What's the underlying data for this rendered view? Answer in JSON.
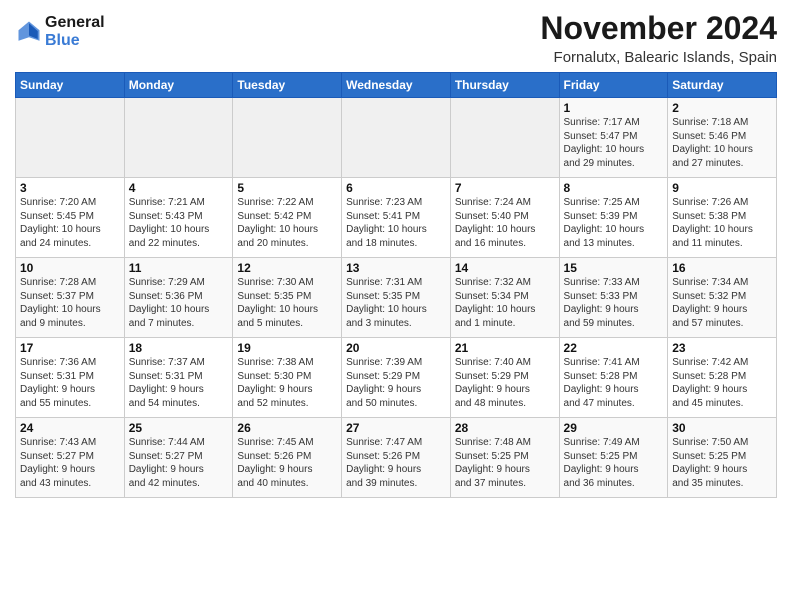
{
  "logo": {
    "line1": "General",
    "line2": "Blue"
  },
  "header": {
    "title": "November 2024",
    "subtitle": "Fornalutx, Balearic Islands, Spain"
  },
  "weekdays": [
    "Sunday",
    "Monday",
    "Tuesday",
    "Wednesday",
    "Thursday",
    "Friday",
    "Saturday"
  ],
  "weeks": [
    [
      {
        "day": "",
        "info": ""
      },
      {
        "day": "",
        "info": ""
      },
      {
        "day": "",
        "info": ""
      },
      {
        "day": "",
        "info": ""
      },
      {
        "day": "",
        "info": ""
      },
      {
        "day": "1",
        "info": "Sunrise: 7:17 AM\nSunset: 5:47 PM\nDaylight: 10 hours\nand 29 minutes."
      },
      {
        "day": "2",
        "info": "Sunrise: 7:18 AM\nSunset: 5:46 PM\nDaylight: 10 hours\nand 27 minutes."
      }
    ],
    [
      {
        "day": "3",
        "info": "Sunrise: 7:20 AM\nSunset: 5:45 PM\nDaylight: 10 hours\nand 24 minutes."
      },
      {
        "day": "4",
        "info": "Sunrise: 7:21 AM\nSunset: 5:43 PM\nDaylight: 10 hours\nand 22 minutes."
      },
      {
        "day": "5",
        "info": "Sunrise: 7:22 AM\nSunset: 5:42 PM\nDaylight: 10 hours\nand 20 minutes."
      },
      {
        "day": "6",
        "info": "Sunrise: 7:23 AM\nSunset: 5:41 PM\nDaylight: 10 hours\nand 18 minutes."
      },
      {
        "day": "7",
        "info": "Sunrise: 7:24 AM\nSunset: 5:40 PM\nDaylight: 10 hours\nand 16 minutes."
      },
      {
        "day": "8",
        "info": "Sunrise: 7:25 AM\nSunset: 5:39 PM\nDaylight: 10 hours\nand 13 minutes."
      },
      {
        "day": "9",
        "info": "Sunrise: 7:26 AM\nSunset: 5:38 PM\nDaylight: 10 hours\nand 11 minutes."
      }
    ],
    [
      {
        "day": "10",
        "info": "Sunrise: 7:28 AM\nSunset: 5:37 PM\nDaylight: 10 hours\nand 9 minutes."
      },
      {
        "day": "11",
        "info": "Sunrise: 7:29 AM\nSunset: 5:36 PM\nDaylight: 10 hours\nand 7 minutes."
      },
      {
        "day": "12",
        "info": "Sunrise: 7:30 AM\nSunset: 5:35 PM\nDaylight: 10 hours\nand 5 minutes."
      },
      {
        "day": "13",
        "info": "Sunrise: 7:31 AM\nSunset: 5:35 PM\nDaylight: 10 hours\nand 3 minutes."
      },
      {
        "day": "14",
        "info": "Sunrise: 7:32 AM\nSunset: 5:34 PM\nDaylight: 10 hours\nand 1 minute."
      },
      {
        "day": "15",
        "info": "Sunrise: 7:33 AM\nSunset: 5:33 PM\nDaylight: 9 hours\nand 59 minutes."
      },
      {
        "day": "16",
        "info": "Sunrise: 7:34 AM\nSunset: 5:32 PM\nDaylight: 9 hours\nand 57 minutes."
      }
    ],
    [
      {
        "day": "17",
        "info": "Sunrise: 7:36 AM\nSunset: 5:31 PM\nDaylight: 9 hours\nand 55 minutes."
      },
      {
        "day": "18",
        "info": "Sunrise: 7:37 AM\nSunset: 5:31 PM\nDaylight: 9 hours\nand 54 minutes."
      },
      {
        "day": "19",
        "info": "Sunrise: 7:38 AM\nSunset: 5:30 PM\nDaylight: 9 hours\nand 52 minutes."
      },
      {
        "day": "20",
        "info": "Sunrise: 7:39 AM\nSunset: 5:29 PM\nDaylight: 9 hours\nand 50 minutes."
      },
      {
        "day": "21",
        "info": "Sunrise: 7:40 AM\nSunset: 5:29 PM\nDaylight: 9 hours\nand 48 minutes."
      },
      {
        "day": "22",
        "info": "Sunrise: 7:41 AM\nSunset: 5:28 PM\nDaylight: 9 hours\nand 47 minutes."
      },
      {
        "day": "23",
        "info": "Sunrise: 7:42 AM\nSunset: 5:28 PM\nDaylight: 9 hours\nand 45 minutes."
      }
    ],
    [
      {
        "day": "24",
        "info": "Sunrise: 7:43 AM\nSunset: 5:27 PM\nDaylight: 9 hours\nand 43 minutes."
      },
      {
        "day": "25",
        "info": "Sunrise: 7:44 AM\nSunset: 5:27 PM\nDaylight: 9 hours\nand 42 minutes."
      },
      {
        "day": "26",
        "info": "Sunrise: 7:45 AM\nSunset: 5:26 PM\nDaylight: 9 hours\nand 40 minutes."
      },
      {
        "day": "27",
        "info": "Sunrise: 7:47 AM\nSunset: 5:26 PM\nDaylight: 9 hours\nand 39 minutes."
      },
      {
        "day": "28",
        "info": "Sunrise: 7:48 AM\nSunset: 5:25 PM\nDaylight: 9 hours\nand 37 minutes."
      },
      {
        "day": "29",
        "info": "Sunrise: 7:49 AM\nSunset: 5:25 PM\nDaylight: 9 hours\nand 36 minutes."
      },
      {
        "day": "30",
        "info": "Sunrise: 7:50 AM\nSunset: 5:25 PM\nDaylight: 9 hours\nand 35 minutes."
      }
    ]
  ]
}
